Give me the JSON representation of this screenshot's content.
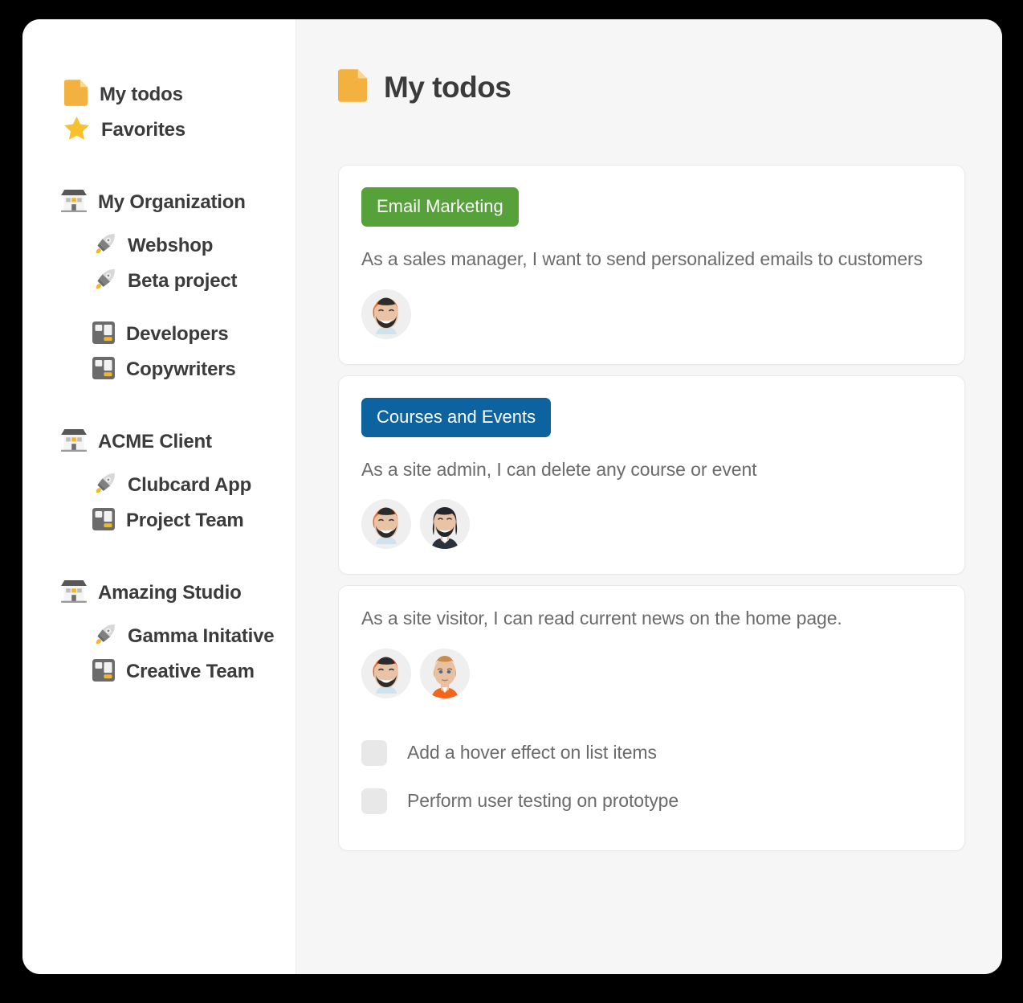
{
  "window": {
    "accents": {
      "yellow": "#f3b23f",
      "green": "#56a13a",
      "blue": "#0c639f",
      "sidebar_bg": "#ffffff",
      "main_bg": "#f6f6f6",
      "text": "#3b3b3b",
      "muted_text": "#6b6b6b"
    }
  },
  "sidebar": {
    "top_items": [
      {
        "label": "My todos",
        "icon": "document-icon"
      },
      {
        "label": "Favorites",
        "icon": "star-icon"
      }
    ],
    "organizations": [
      {
        "label": "My Organization",
        "icon": "organization-icon",
        "projects": [
          {
            "label": "Webshop",
            "icon": "rocket-icon"
          },
          {
            "label": "Beta project",
            "icon": "rocket-icon"
          }
        ],
        "teams": [
          {
            "label": "Developers",
            "icon": "team-icon"
          },
          {
            "label": "Copywriters",
            "icon": "team-icon"
          }
        ]
      },
      {
        "label": "ACME Client",
        "icon": "organization-icon",
        "projects": [
          {
            "label": "Clubcard App",
            "icon": "rocket-icon"
          }
        ],
        "teams": [
          {
            "label": "Project Team",
            "icon": "team-icon"
          }
        ]
      },
      {
        "label": "Amazing Studio",
        "icon": "organization-icon",
        "projects": [
          {
            "label": "Gamma Initative",
            "icon": "rocket-icon"
          }
        ],
        "teams": [
          {
            "label": "Creative Team",
            "icon": "team-icon"
          }
        ]
      }
    ]
  },
  "page": {
    "icon": "document-icon",
    "title": "My todos"
  },
  "cards": [
    {
      "badge": {
        "label": "Email Marketing",
        "color": "green"
      },
      "story": "As a sales manager, I want to send personalized emails to customers",
      "avatars": [
        "avatar-orange-hair-beard"
      ],
      "todos": []
    },
    {
      "badge": {
        "label": "Courses and Events",
        "color": "blue"
      },
      "story": "As a site admin, I can delete any course or event",
      "avatars": [
        "avatar-orange-hair-beard",
        "avatar-dark-hair-suit"
      ],
      "todos": []
    },
    {
      "badge": null,
      "story": "As a site visitor, I can read current news on the home page.",
      "avatars": [
        "avatar-orange-hair-beard",
        "avatar-blonde-orange-shirt"
      ],
      "todos": [
        {
          "label": "Add a hover effect on list items",
          "checked": false
        },
        {
          "label": "Perform user testing on prototype",
          "checked": false
        }
      ]
    }
  ]
}
